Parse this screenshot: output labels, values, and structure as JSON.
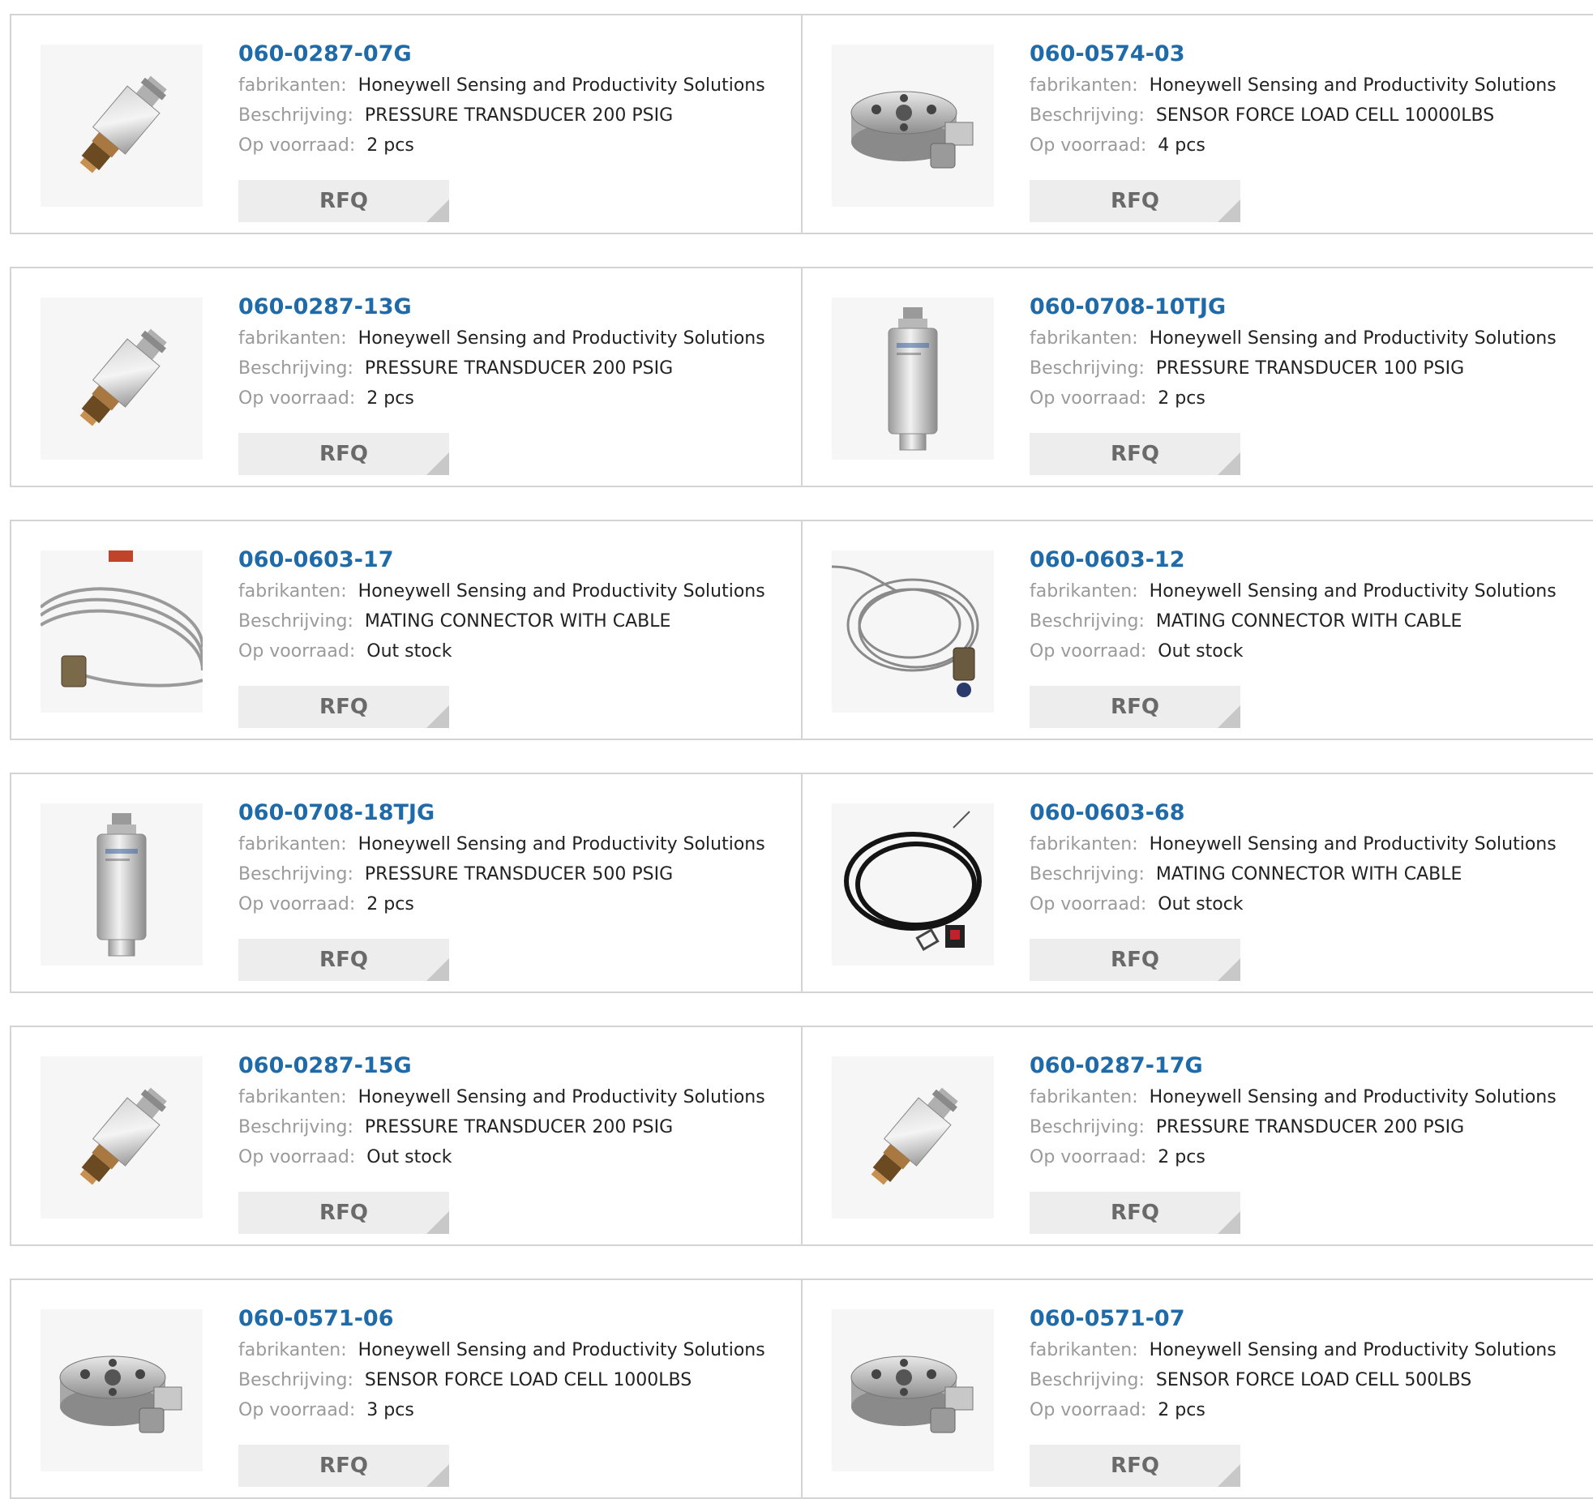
{
  "labels": {
    "manufacturer": "fabrikanten:",
    "description": "Beschrijving:",
    "stock": "Op voorraad:",
    "rfq": "RFQ"
  },
  "products": [
    {
      "part": "060-0287-07G",
      "manufacturer": "Honeywell Sensing and Productivity Solutions",
      "description": "PRESSURE TRANSDUCER 200 PSIG",
      "stock": "2 pcs",
      "image": "pressure-transducer-angled"
    },
    {
      "part": "060-0574-03",
      "manufacturer": "Honeywell Sensing and Productivity Solutions",
      "description": "SENSOR FORCE LOAD CELL 10000LBS",
      "stock": "4 pcs",
      "image": "load-cell"
    },
    {
      "part": "060-0287-13G",
      "manufacturer": "Honeywell Sensing and Productivity Solutions",
      "description": "PRESSURE TRANSDUCER 200 PSIG",
      "stock": "2 pcs",
      "image": "pressure-transducer-angled"
    },
    {
      "part": "060-0708-10TJG",
      "manufacturer": "Honeywell Sensing and Productivity Solutions",
      "description": "PRESSURE TRANSDUCER 100 PSIG",
      "stock": "2 pcs",
      "image": "pressure-transducer-vertical"
    },
    {
      "part": "060-0603-17",
      "manufacturer": "Honeywell Sensing and Productivity Solutions",
      "description": "MATING CONNECTOR WITH CABLE",
      "stock": "Out stock",
      "image": "cable-gray"
    },
    {
      "part": "060-0603-12",
      "manufacturer": "Honeywell Sensing and Productivity Solutions",
      "description": "MATING CONNECTOR WITH CABLE",
      "stock": "Out stock",
      "image": "cable-coil"
    },
    {
      "part": "060-0708-18TJG",
      "manufacturer": "Honeywell Sensing and Productivity Solutions",
      "description": "PRESSURE TRANSDUCER 500 PSIG",
      "stock": "2 pcs",
      "image": "pressure-transducer-vertical"
    },
    {
      "part": "060-0603-68",
      "manufacturer": "Honeywell Sensing and Productivity Solutions",
      "description": "MATING CONNECTOR WITH CABLE",
      "stock": "Out stock",
      "image": "cable-black"
    },
    {
      "part": "060-0287-15G",
      "manufacturer": "Honeywell Sensing and Productivity Solutions",
      "description": "PRESSURE TRANSDUCER 200 PSIG",
      "stock": "Out stock",
      "image": "pressure-transducer-angled"
    },
    {
      "part": "060-0287-17G",
      "manufacturer": "Honeywell Sensing and Productivity Solutions",
      "description": "PRESSURE TRANSDUCER 200 PSIG",
      "stock": "2 pcs",
      "image": "pressure-transducer-angled"
    },
    {
      "part": "060-0571-06",
      "manufacturer": "Honeywell Sensing and Productivity Solutions",
      "description": "SENSOR FORCE LOAD CELL 1000LBS",
      "stock": "3 pcs",
      "image": "load-cell"
    },
    {
      "part": "060-0571-07",
      "manufacturer": "Honeywell Sensing and Productivity Solutions",
      "description": "SENSOR FORCE LOAD CELL 500LBS",
      "stock": "2 pcs",
      "image": "load-cell"
    }
  ]
}
